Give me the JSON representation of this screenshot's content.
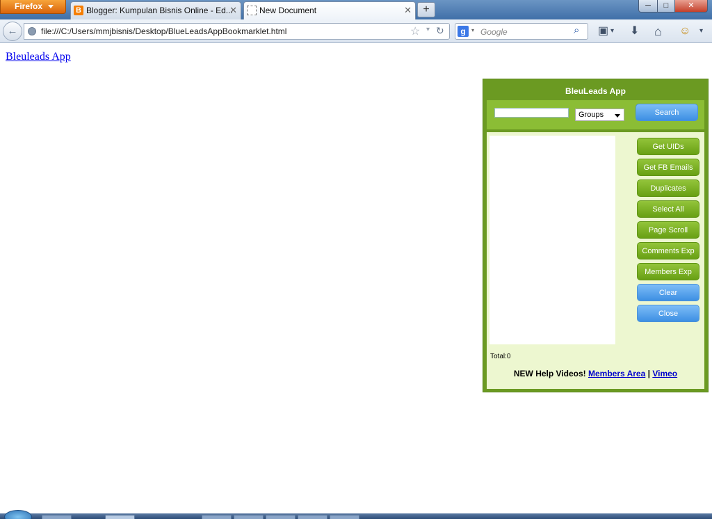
{
  "browser": {
    "menu_label": "Firefox",
    "tabs": [
      {
        "title": "Blogger: Kumpulan Bisnis Online - Ed...",
        "active": false,
        "icon": "blogger-icon"
      },
      {
        "title": "New Document",
        "active": true,
        "icon": "document-icon"
      }
    ],
    "new_tab": "+",
    "window_controls": {
      "minimize": "─",
      "maximize": "□",
      "close": "✕"
    },
    "url": "file:///C:/Users/mmjbisnis/Desktop/BlueLeadsAppBookmarklet.html",
    "search_placeholder": "Google",
    "icons": {
      "back": "←",
      "star": "☆",
      "dropmarker": "▾",
      "reload": "↻",
      "search_engine": "g",
      "magnifier": "⌕",
      "bookmarks": "▣",
      "download": "⬇",
      "home": "⌂",
      "addon": "☺",
      "menu": "▾"
    }
  },
  "page": {
    "link_text": "Bleuleads App"
  },
  "app": {
    "title": "BleuLeads App",
    "search_value": "",
    "select_value": "Groups",
    "search_button": "Search",
    "buttons": [
      {
        "label": "Get UIDs",
        "style": "green"
      },
      {
        "label": "Get FB Emails",
        "style": "green"
      },
      {
        "label": "Duplicates",
        "style": "green"
      },
      {
        "label": "Select All",
        "style": "green"
      },
      {
        "label": "Page Scroll",
        "style": "green"
      },
      {
        "label": "Comments Exp",
        "style": "green"
      },
      {
        "label": "Members Exp",
        "style": "green"
      },
      {
        "label": "Clear",
        "style": "blue"
      },
      {
        "label": "Close",
        "style": "blue"
      }
    ],
    "total_text": "Total:0",
    "help_prefix": "NEW Help Videos!",
    "help_link_1": "Members Area",
    "help_sep": "|",
    "help_link_2": "Vimeo"
  },
  "colors": {
    "panel_border": "#6b9a22",
    "search_strip": "#8bbd35",
    "panel_body": "#edf7d0",
    "button_green": "#68a014",
    "button_blue": "#3d8fe3",
    "link": "#0000ee"
  }
}
